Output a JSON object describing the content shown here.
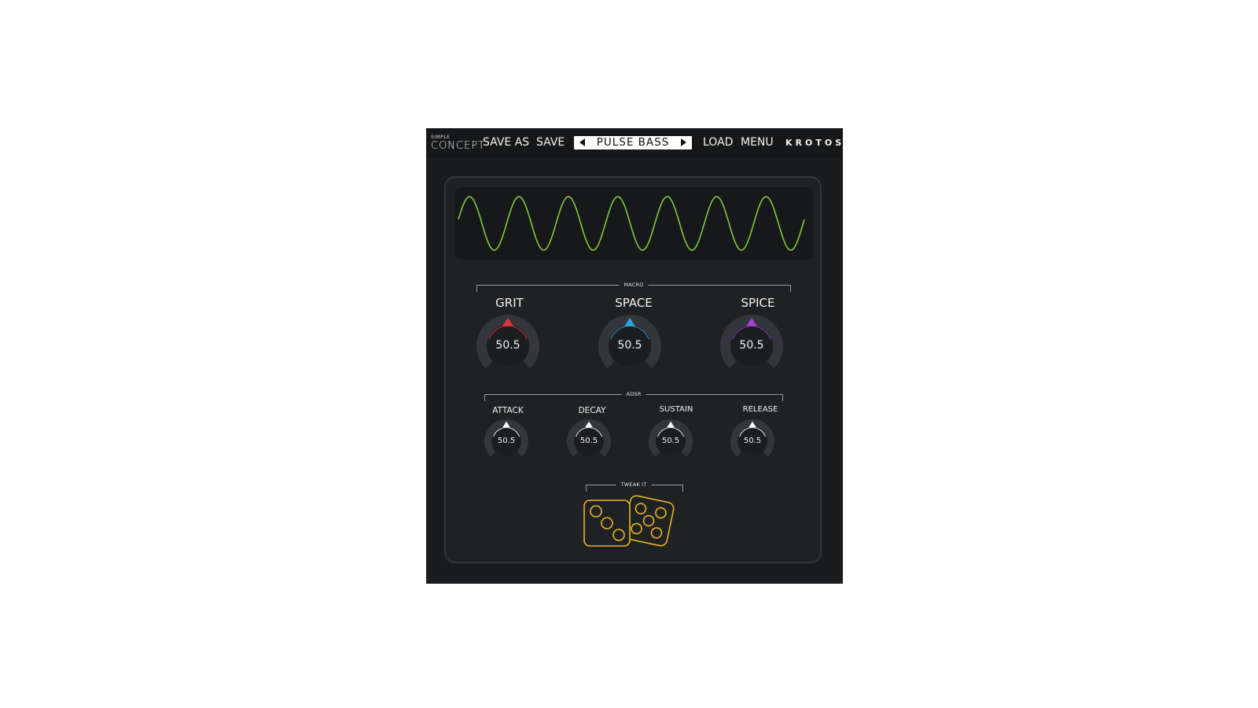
{
  "topbar": {
    "logo_small": "SIMPLE",
    "logo_big": "CONCEPT",
    "save_as": "SAVE AS",
    "save": "SAVE",
    "preset_name": "PULSE BASS",
    "load": "LOAD",
    "menu": "MENU",
    "brand": "KROTOS"
  },
  "waveform": {
    "type": "sine",
    "cycles": 7,
    "color": "#7ccd3a"
  },
  "macro": {
    "label": "MACRO",
    "knobs": [
      {
        "label": "GRIT",
        "value": "50.5",
        "color": "#e0323c"
      },
      {
        "label": "SPACE",
        "value": "50.5",
        "color": "#2aa3e0"
      },
      {
        "label": "SPICE",
        "value": "50.5",
        "color": "#a83ed8"
      }
    ]
  },
  "adsr": {
    "label": "ADSR",
    "knobs": [
      {
        "label": "ATTACK",
        "value": "50.5",
        "color": "#ffffff"
      },
      {
        "label": "DECAY",
        "value": "50.5",
        "color": "#ffffff"
      },
      {
        "label": "SUSTAIN",
        "value": "50.5",
        "color": "#ffffff"
      },
      {
        "label": "RELEASE",
        "value": "50.5",
        "color": "#ffffff"
      }
    ]
  },
  "tweak": {
    "label": "TWEAK IT",
    "icon": "dice-icon",
    "color": "#e8b524"
  }
}
